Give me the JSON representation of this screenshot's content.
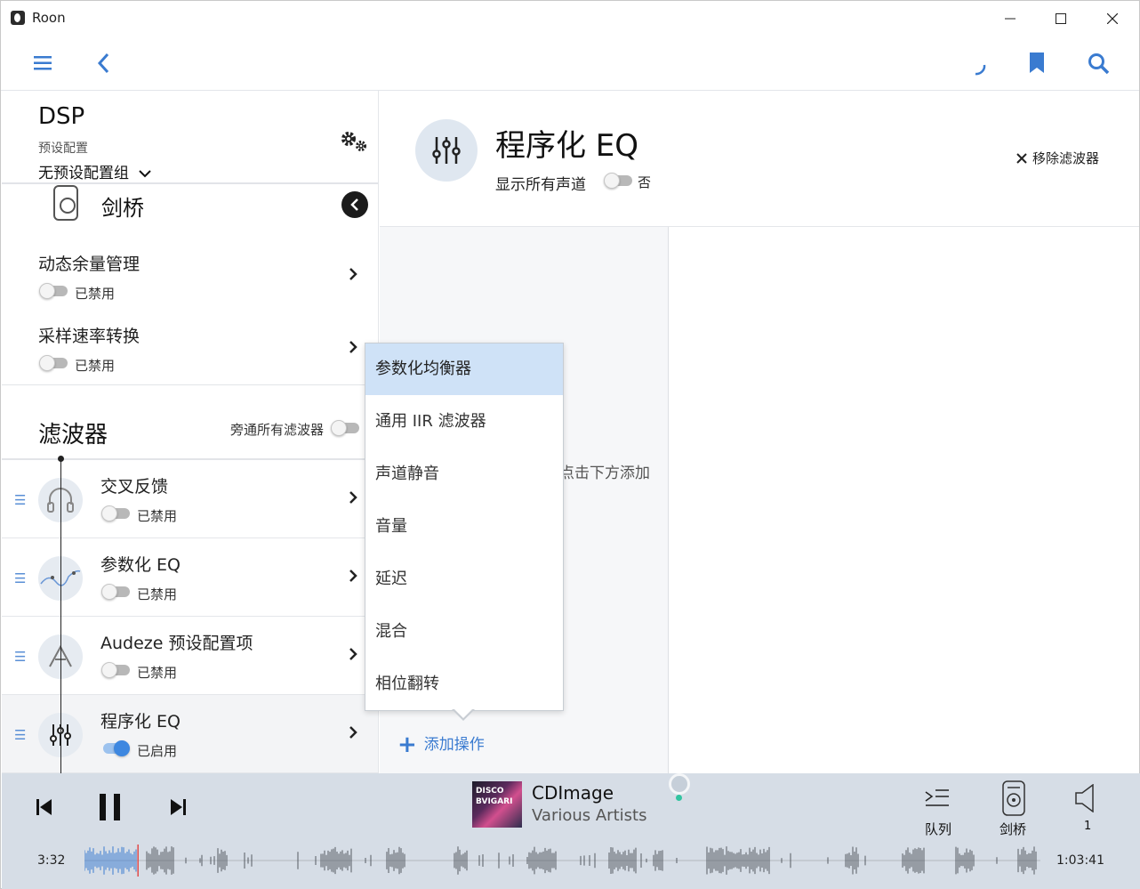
{
  "window": {
    "title": "Roon"
  },
  "left": {
    "dsp_title": "DSP",
    "preset_label": "预设配置",
    "preset_value": "无预设配置组",
    "zone_name": "剑桥",
    "sections": [
      {
        "title": "动态余量管理",
        "state": "已禁用"
      },
      {
        "title": "采样速率转换",
        "state": "已禁用"
      }
    ],
    "filters_title": "滤波器",
    "bypass_label": "旁通所有滤波器",
    "filters": [
      {
        "title": "交叉反馈",
        "state": "已禁用"
      },
      {
        "title": "参数化 EQ",
        "state": "已禁用"
      },
      {
        "title": "Audeze 预设配置项",
        "state": "已禁用"
      },
      {
        "title": "程序化 EQ",
        "state": "已启用"
      }
    ]
  },
  "right": {
    "title": "程序化 EQ",
    "show_channels": "显示所有声道",
    "show_channels_value": "否",
    "remove_filter": "移除滤波器",
    "hint": "点击下方添加",
    "add_operation": "添加操作"
  },
  "dropdown": {
    "items": [
      "参数化均衡器",
      "通用 IIR 滤波器",
      "声道静音",
      "音量",
      "延迟",
      "混合",
      "相位翻转"
    ]
  },
  "player": {
    "album_text": "DISCO BVIGARI",
    "track_title": "CDImage",
    "track_artist": "Various Artists",
    "queue_label": "队列",
    "zone_label": "剑桥",
    "volume_value": "1",
    "elapsed": "3:32",
    "total": "1:03:41",
    "progress": 0.056
  },
  "colors": {
    "accent": "#3a7bd0",
    "toggle_on": "#3d87e0",
    "player_bg": "#d6dde6",
    "selected": "#cfe2f7"
  }
}
